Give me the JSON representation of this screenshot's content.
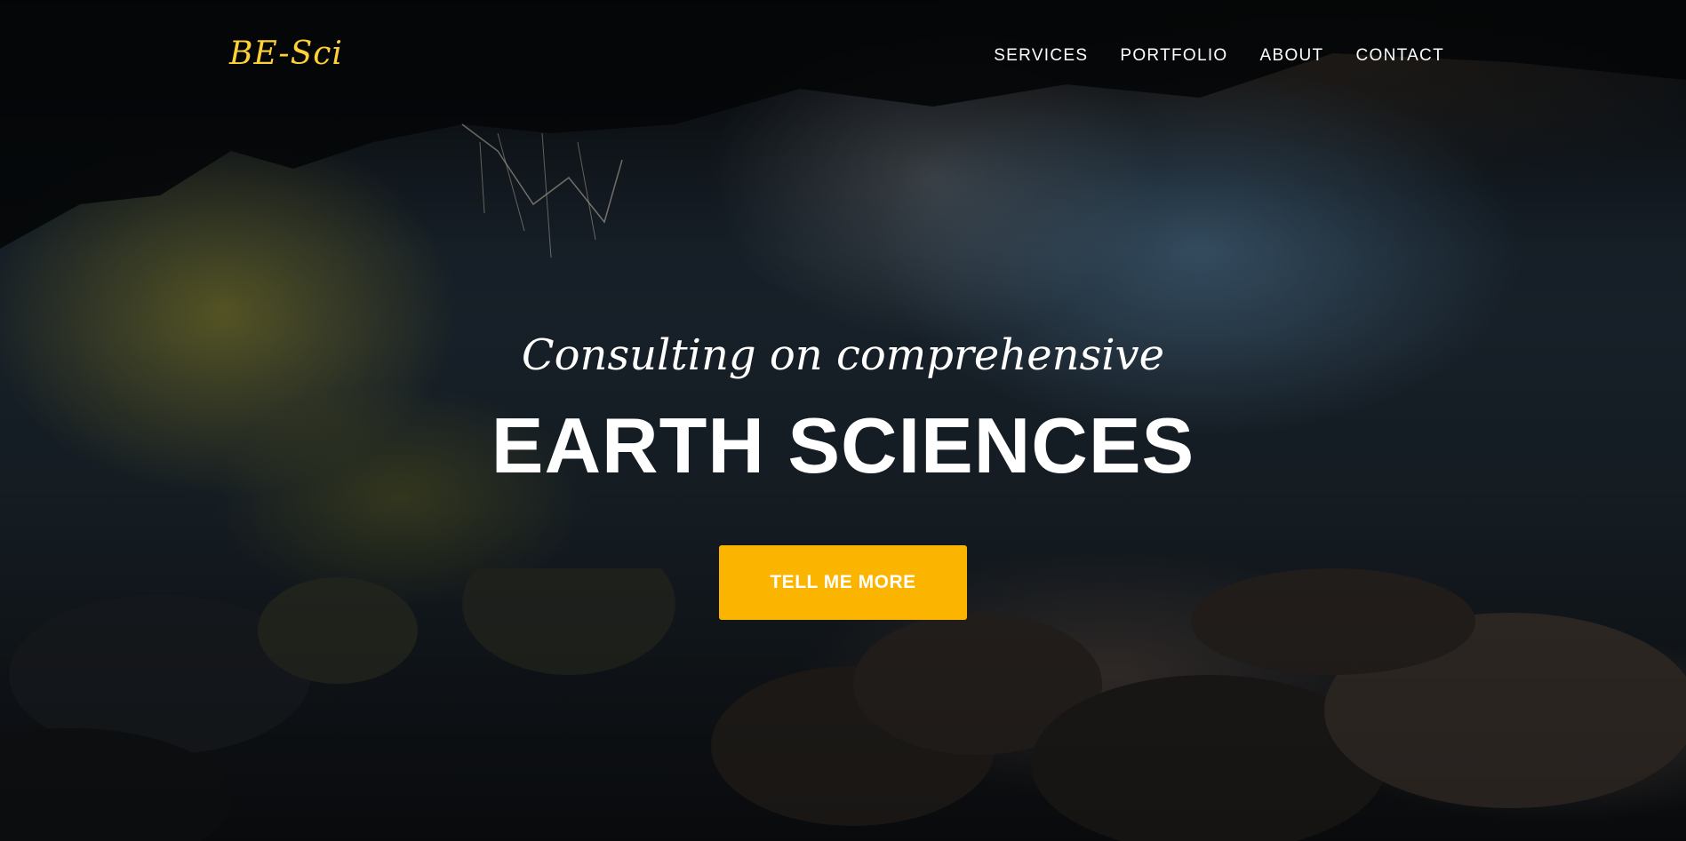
{
  "nav": {
    "brand": "BE-Sci",
    "items": [
      {
        "label": "SERVICES"
      },
      {
        "label": "PORTFOLIO"
      },
      {
        "label": "ABOUT"
      },
      {
        "label": "CONTACT"
      }
    ]
  },
  "hero": {
    "lead_in": "Consulting on comprehensive",
    "heading": "EARTH SCIENCES",
    "cta_label": "TELL ME MORE",
    "background_image": "cave interior with mossy rocks and foliage"
  },
  "colors": {
    "brand": "#fed136",
    "cta": "#fbb500",
    "text": "#ffffff"
  }
}
